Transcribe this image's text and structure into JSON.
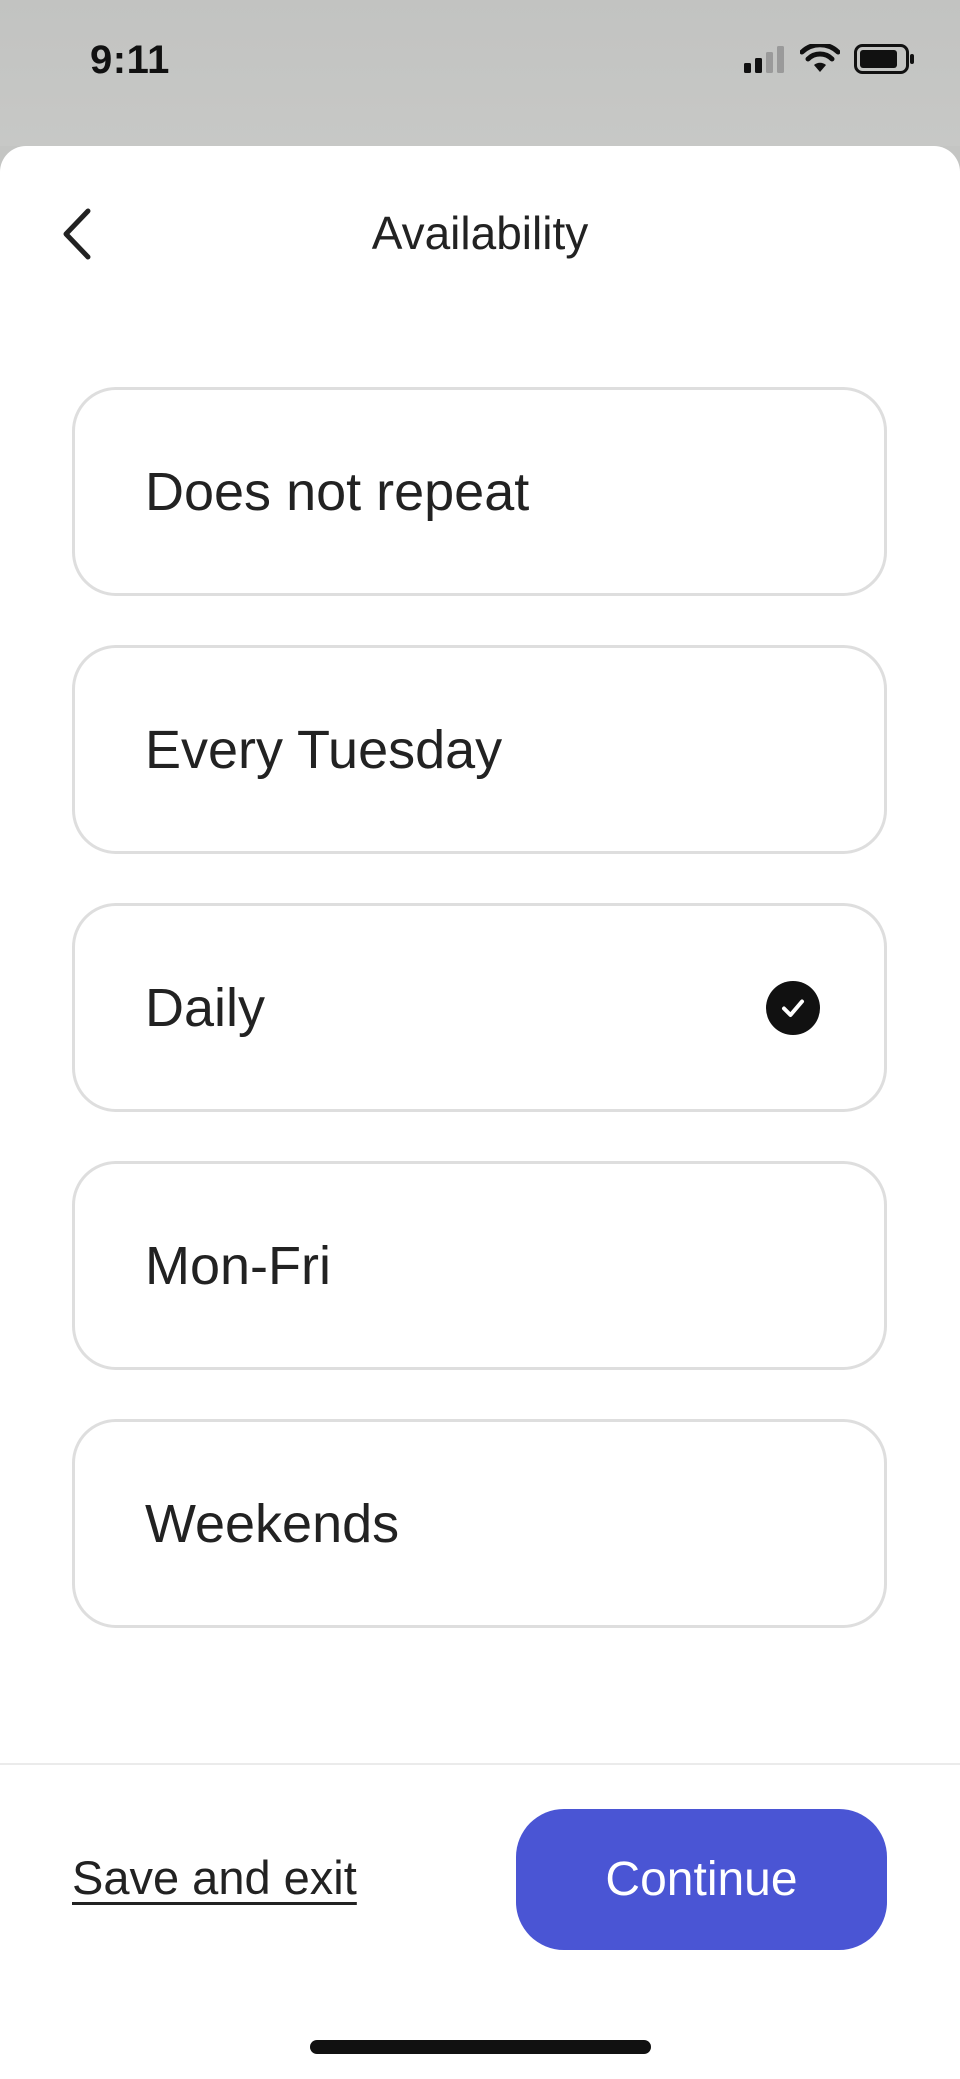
{
  "status_bar": {
    "time": "9:11",
    "icons": [
      "cellular-signal-icon",
      "wifi-icon",
      "battery-icon"
    ]
  },
  "header": {
    "title": "Availability",
    "back_icon": "chevron-left-icon"
  },
  "options": [
    {
      "label": "Does not repeat",
      "selected": false
    },
    {
      "label": "Every Tuesday",
      "selected": false
    },
    {
      "label": "Daily",
      "selected": true
    },
    {
      "label": "Mon-Fri",
      "selected": false
    },
    {
      "label": "Weekends",
      "selected": false
    }
  ],
  "footer": {
    "save_exit_label": "Save and exit",
    "continue_label": "Continue"
  },
  "colors": {
    "accent": "#4a55d4",
    "check": "#111111",
    "border": "#dedede"
  }
}
